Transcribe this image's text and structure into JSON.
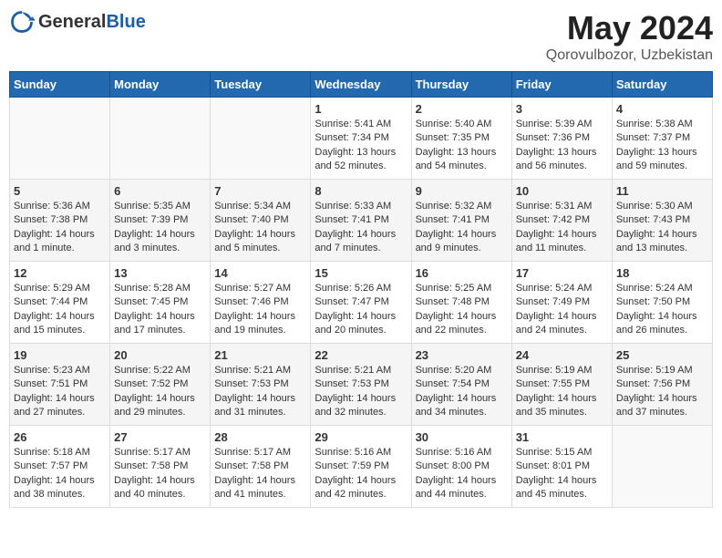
{
  "header": {
    "logo_general": "General",
    "logo_blue": "Blue",
    "title": "May 2024",
    "location": "Qorovulbozor, Uzbekistan"
  },
  "weekdays": [
    "Sunday",
    "Monday",
    "Tuesday",
    "Wednesday",
    "Thursday",
    "Friday",
    "Saturday"
  ],
  "weeks": [
    [
      {
        "day": "",
        "sunrise": "",
        "sunset": "",
        "daylight": "",
        "empty": true
      },
      {
        "day": "",
        "sunrise": "",
        "sunset": "",
        "daylight": "",
        "empty": true
      },
      {
        "day": "",
        "sunrise": "",
        "sunset": "",
        "daylight": "",
        "empty": true
      },
      {
        "day": "1",
        "sunrise": "Sunrise: 5:41 AM",
        "sunset": "Sunset: 7:34 PM",
        "daylight": "Daylight: 13 hours and 52 minutes."
      },
      {
        "day": "2",
        "sunrise": "Sunrise: 5:40 AM",
        "sunset": "Sunset: 7:35 PM",
        "daylight": "Daylight: 13 hours and 54 minutes."
      },
      {
        "day": "3",
        "sunrise": "Sunrise: 5:39 AM",
        "sunset": "Sunset: 7:36 PM",
        "daylight": "Daylight: 13 hours and 56 minutes."
      },
      {
        "day": "4",
        "sunrise": "Sunrise: 5:38 AM",
        "sunset": "Sunset: 7:37 PM",
        "daylight": "Daylight: 13 hours and 59 minutes."
      }
    ],
    [
      {
        "day": "5",
        "sunrise": "Sunrise: 5:36 AM",
        "sunset": "Sunset: 7:38 PM",
        "daylight": "Daylight: 14 hours and 1 minute."
      },
      {
        "day": "6",
        "sunrise": "Sunrise: 5:35 AM",
        "sunset": "Sunset: 7:39 PM",
        "daylight": "Daylight: 14 hours and 3 minutes."
      },
      {
        "day": "7",
        "sunrise": "Sunrise: 5:34 AM",
        "sunset": "Sunset: 7:40 PM",
        "daylight": "Daylight: 14 hours and 5 minutes."
      },
      {
        "day": "8",
        "sunrise": "Sunrise: 5:33 AM",
        "sunset": "Sunset: 7:41 PM",
        "daylight": "Daylight: 14 hours and 7 minutes."
      },
      {
        "day": "9",
        "sunrise": "Sunrise: 5:32 AM",
        "sunset": "Sunset: 7:41 PM",
        "daylight": "Daylight: 14 hours and 9 minutes."
      },
      {
        "day": "10",
        "sunrise": "Sunrise: 5:31 AM",
        "sunset": "Sunset: 7:42 PM",
        "daylight": "Daylight: 14 hours and 11 minutes."
      },
      {
        "day": "11",
        "sunrise": "Sunrise: 5:30 AM",
        "sunset": "Sunset: 7:43 PM",
        "daylight": "Daylight: 14 hours and 13 minutes."
      }
    ],
    [
      {
        "day": "12",
        "sunrise": "Sunrise: 5:29 AM",
        "sunset": "Sunset: 7:44 PM",
        "daylight": "Daylight: 14 hours and 15 minutes."
      },
      {
        "day": "13",
        "sunrise": "Sunrise: 5:28 AM",
        "sunset": "Sunset: 7:45 PM",
        "daylight": "Daylight: 14 hours and 17 minutes."
      },
      {
        "day": "14",
        "sunrise": "Sunrise: 5:27 AM",
        "sunset": "Sunset: 7:46 PM",
        "daylight": "Daylight: 14 hours and 19 minutes."
      },
      {
        "day": "15",
        "sunrise": "Sunrise: 5:26 AM",
        "sunset": "Sunset: 7:47 PM",
        "daylight": "Daylight: 14 hours and 20 minutes."
      },
      {
        "day": "16",
        "sunrise": "Sunrise: 5:25 AM",
        "sunset": "Sunset: 7:48 PM",
        "daylight": "Daylight: 14 hours and 22 minutes."
      },
      {
        "day": "17",
        "sunrise": "Sunrise: 5:24 AM",
        "sunset": "Sunset: 7:49 PM",
        "daylight": "Daylight: 14 hours and 24 minutes."
      },
      {
        "day": "18",
        "sunrise": "Sunrise: 5:24 AM",
        "sunset": "Sunset: 7:50 PM",
        "daylight": "Daylight: 14 hours and 26 minutes."
      }
    ],
    [
      {
        "day": "19",
        "sunrise": "Sunrise: 5:23 AM",
        "sunset": "Sunset: 7:51 PM",
        "daylight": "Daylight: 14 hours and 27 minutes."
      },
      {
        "day": "20",
        "sunrise": "Sunrise: 5:22 AM",
        "sunset": "Sunset: 7:52 PM",
        "daylight": "Daylight: 14 hours and 29 minutes."
      },
      {
        "day": "21",
        "sunrise": "Sunrise: 5:21 AM",
        "sunset": "Sunset: 7:53 PM",
        "daylight": "Daylight: 14 hours and 31 minutes."
      },
      {
        "day": "22",
        "sunrise": "Sunrise: 5:21 AM",
        "sunset": "Sunset: 7:53 PM",
        "daylight": "Daylight: 14 hours and 32 minutes."
      },
      {
        "day": "23",
        "sunrise": "Sunrise: 5:20 AM",
        "sunset": "Sunset: 7:54 PM",
        "daylight": "Daylight: 14 hours and 34 minutes."
      },
      {
        "day": "24",
        "sunrise": "Sunrise: 5:19 AM",
        "sunset": "Sunset: 7:55 PM",
        "daylight": "Daylight: 14 hours and 35 minutes."
      },
      {
        "day": "25",
        "sunrise": "Sunrise: 5:19 AM",
        "sunset": "Sunset: 7:56 PM",
        "daylight": "Daylight: 14 hours and 37 minutes."
      }
    ],
    [
      {
        "day": "26",
        "sunrise": "Sunrise: 5:18 AM",
        "sunset": "Sunset: 7:57 PM",
        "daylight": "Daylight: 14 hours and 38 minutes."
      },
      {
        "day": "27",
        "sunrise": "Sunrise: 5:17 AM",
        "sunset": "Sunset: 7:58 PM",
        "daylight": "Daylight: 14 hours and 40 minutes."
      },
      {
        "day": "28",
        "sunrise": "Sunrise: 5:17 AM",
        "sunset": "Sunset: 7:58 PM",
        "daylight": "Daylight: 14 hours and 41 minutes."
      },
      {
        "day": "29",
        "sunrise": "Sunrise: 5:16 AM",
        "sunset": "Sunset: 7:59 PM",
        "daylight": "Daylight: 14 hours and 42 minutes."
      },
      {
        "day": "30",
        "sunrise": "Sunrise: 5:16 AM",
        "sunset": "Sunset: 8:00 PM",
        "daylight": "Daylight: 14 hours and 44 minutes."
      },
      {
        "day": "31",
        "sunrise": "Sunrise: 5:15 AM",
        "sunset": "Sunset: 8:01 PM",
        "daylight": "Daylight: 14 hours and 45 minutes."
      },
      {
        "day": "",
        "sunrise": "",
        "sunset": "",
        "daylight": "",
        "empty": true
      }
    ]
  ]
}
